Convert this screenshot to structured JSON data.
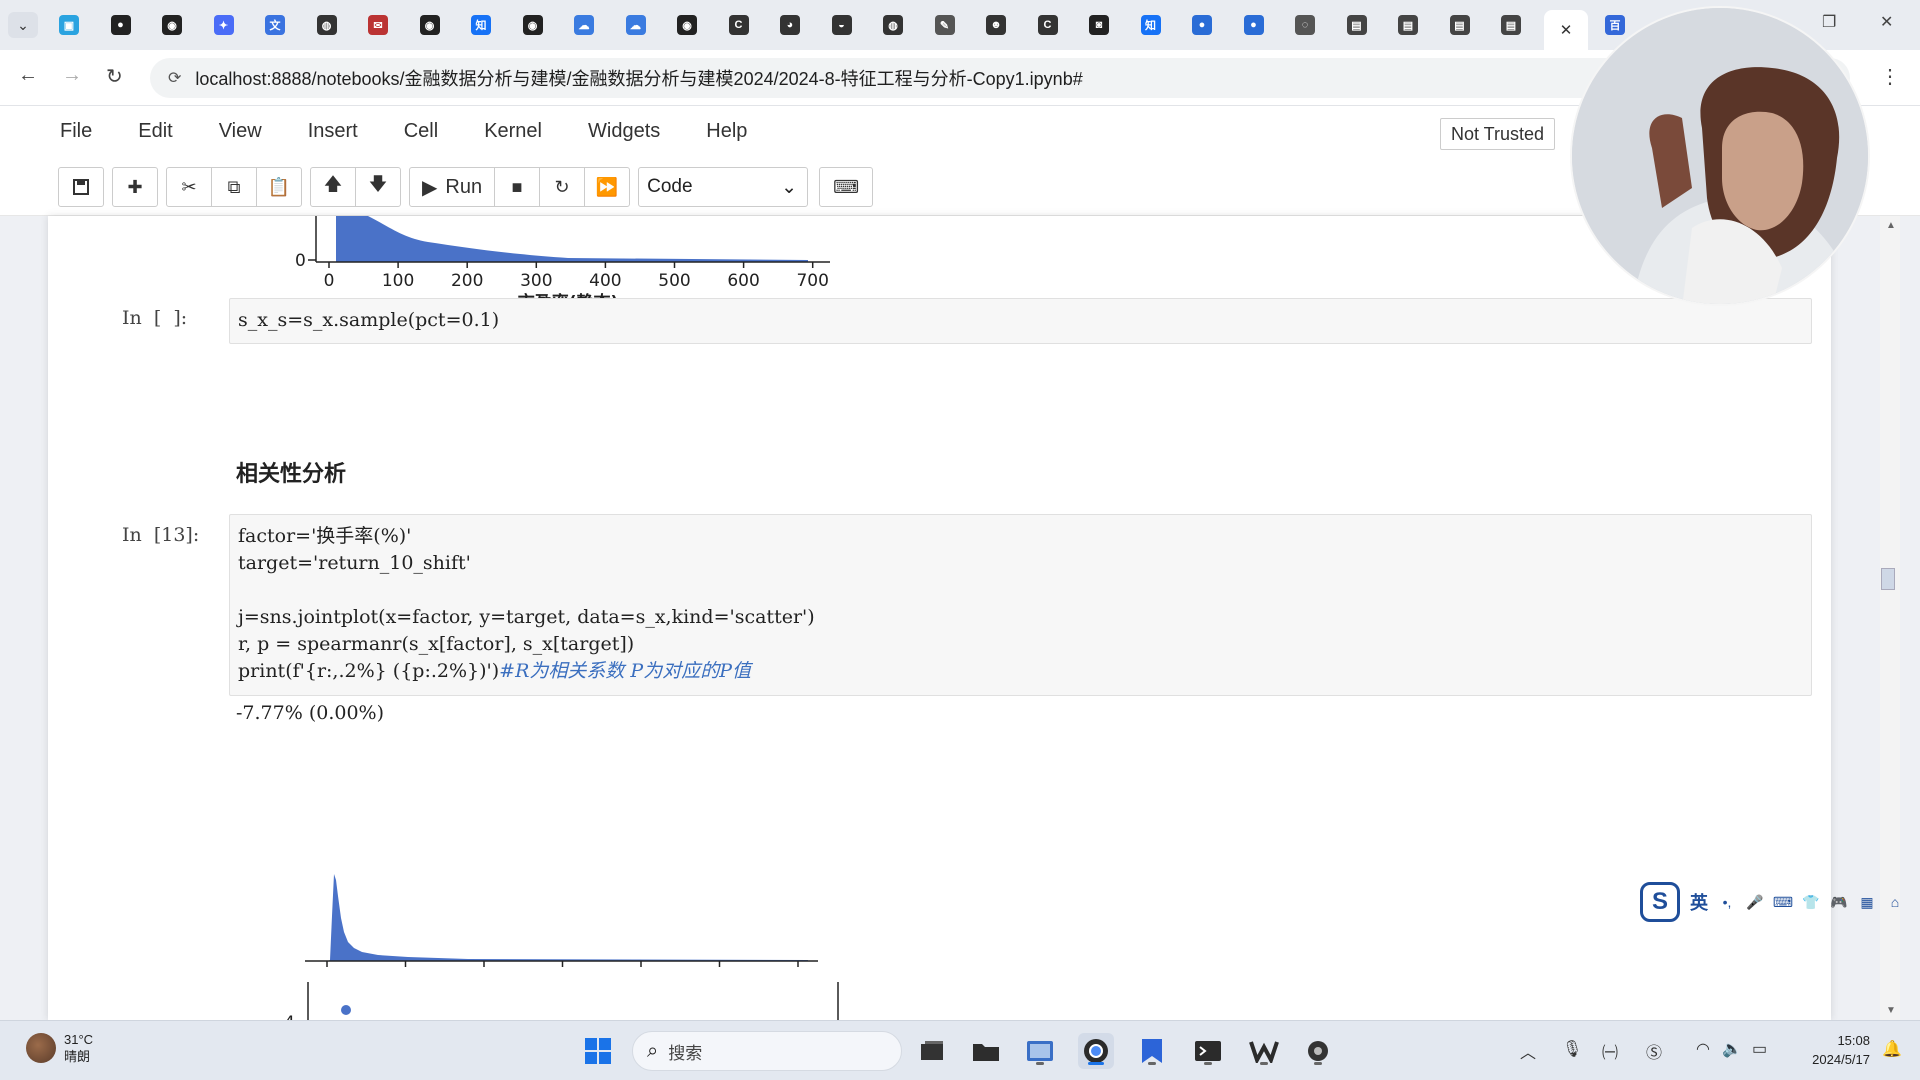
{
  "browser": {
    "tab_dropdown": "⌄",
    "tabs": [
      {
        "icon": "bilibili-icon",
        "color": "#2aa3e0"
      },
      {
        "icon": "video-record-icon",
        "color": "#222"
      },
      {
        "icon": "github-icon",
        "color": "#222"
      },
      {
        "icon": "ai-tool-icon",
        "color": "#4a6cf7"
      },
      {
        "icon": "translate-icon",
        "color": "#3a73e0"
      },
      {
        "icon": "globe-icon",
        "color": "#333"
      },
      {
        "icon": "mail-icon",
        "color": "#b33"
      },
      {
        "icon": "github-icon",
        "color": "#222"
      },
      {
        "icon": "zhihu-icon",
        "color": "#1772f6"
      },
      {
        "icon": "github-icon",
        "color": "#222"
      },
      {
        "icon": "cloud-icon",
        "color": "#3a7be0"
      },
      {
        "icon": "cloud-icon",
        "color": "#3a7be0"
      },
      {
        "icon": "github-icon",
        "color": "#222"
      },
      {
        "icon": "c-letter-icon",
        "color": "#333"
      },
      {
        "icon": "chat-icon",
        "color": "#333"
      },
      {
        "icon": "chat-bubble-icon",
        "color": "#333"
      },
      {
        "icon": "globe-icon",
        "color": "#333"
      },
      {
        "icon": "feather-icon",
        "color": "#555"
      },
      {
        "icon": "robot-icon",
        "color": "#333"
      },
      {
        "icon": "c-letter-icon",
        "color": "#333"
      },
      {
        "icon": "camera-icon",
        "color": "#222"
      },
      {
        "icon": "zhihu-icon",
        "color": "#1772f6"
      },
      {
        "icon": "blue-circle-icon",
        "color": "#2a6cd6"
      },
      {
        "icon": "blue-circle-icon",
        "color": "#2a6cd6"
      },
      {
        "icon": "loading-icon",
        "color": "#555"
      },
      {
        "icon": "notebook-icon",
        "color": "#444"
      },
      {
        "icon": "notebook-icon",
        "color": "#444"
      },
      {
        "icon": "notebook-icon",
        "color": "#444"
      },
      {
        "icon": "notebook-icon",
        "color": "#444"
      }
    ],
    "active_tab_close": "✕",
    "extra_tab_icon": "baidu-icon",
    "url": "localhost:8888/notebooks/金融数据分析与建模/金融数据分析与建模2024/2024-8-特征工程与分析-Copy1.ipynb#"
  },
  "jupyter": {
    "menus": [
      "File",
      "Edit",
      "View",
      "Insert",
      "Cell",
      "Kernel",
      "Widgets",
      "Help"
    ],
    "trust_status": "Not Trusted",
    "run_label": "Run",
    "cell_type": "Code"
  },
  "notebook": {
    "top_chart": {
      "y_tick": "0",
      "x_ticks": [
        "0",
        "100",
        "200",
        "300",
        "400",
        "500",
        "600",
        "700"
      ],
      "x_label": "市盈率(静态)"
    },
    "cell1": {
      "prompt": "In  [  ]:",
      "code": [
        "s_x_s=s_x.sample(pct=0.1)"
      ]
    },
    "heading": "相关性分析",
    "cell2": {
      "prompt": "In  [13]:",
      "code": [
        "factor='换手率(%)'",
        "target='return_10_shift'",
        "",
        "j=sns.jointplot(x=factor, y=target, data=s_x,kind='scatter')",
        "r, p = spearmanr(s_x[factor], s_x[target])"
      ],
      "print_code": "print(f'{r:,.2%} ({p:.2%})')",
      "print_comment": "#R为相关系数 P为对应的P值"
    },
    "output": "-7.77% (0.00%)",
    "joint_chart": {
      "y_tick": "4"
    }
  },
  "ime": {
    "mode": "英"
  },
  "taskbar": {
    "temperature": "31°C",
    "weather": "晴朗",
    "search_placeholder": "搜索",
    "time": "15:08",
    "date": "2024/5/17"
  }
}
